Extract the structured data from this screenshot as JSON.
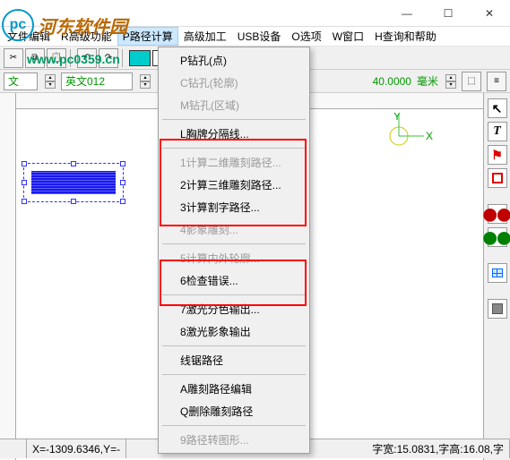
{
  "window": {
    "minimize": "—",
    "maximize": "☐",
    "close": "✕"
  },
  "watermark": {
    "logo_initials": "pc",
    "site_name": "河东软件园",
    "url": "www.pc0359.cn"
  },
  "menubar": {
    "items": [
      "文件编辑",
      "R高级功能",
      "P路径计算",
      "高级加工",
      "USB设备",
      "O选项",
      "W窗口",
      "H查询和帮助"
    ]
  },
  "toolbar1": {
    "colors": {
      "cyan": "#00cccc",
      "white": "#ffffff",
      "green": "#00cc00"
    }
  },
  "toolbar2": {
    "font_group": "文",
    "font_name": "英文012",
    "size_value": "40.0000",
    "size_unit": "毫米"
  },
  "dropdown": {
    "items": [
      {
        "label": "P钻孔(点)",
        "enabled": true
      },
      {
        "label": "C钻孔(轮廓)",
        "enabled": false
      },
      {
        "label": "M钻孔(区域)",
        "enabled": false
      },
      {
        "sep": true
      },
      {
        "label": "L胸牌分隔线...",
        "enabled": true
      },
      {
        "sep": true
      },
      {
        "label": "1计算二维雕刻路径...",
        "enabled": false
      },
      {
        "label": "2计算三维雕刻路径...",
        "enabled": true
      },
      {
        "label": "3计算割字路径...",
        "enabled": true
      },
      {
        "label": "4影象雕刻...",
        "enabled": false
      },
      {
        "sep": true
      },
      {
        "label": "5计算内外轮廓...",
        "enabled": false
      },
      {
        "label": "6检查错误...",
        "enabled": true
      },
      {
        "sep": true
      },
      {
        "label": "7激光分色输出...",
        "enabled": true
      },
      {
        "label": "8激光影象输出",
        "enabled": true
      },
      {
        "sep": true
      },
      {
        "label": "线锯路径",
        "enabled": true
      },
      {
        "sep": true
      },
      {
        "label": "A雕刻路径编辑",
        "enabled": true
      },
      {
        "label": "Q删除雕刻路径",
        "enabled": true
      },
      {
        "sep": true
      },
      {
        "label": "9路径转图形...",
        "enabled": false
      }
    ]
  },
  "origin": {
    "x": "X",
    "y": "Y"
  },
  "statusbar": {
    "coords": "X=-1309.6346,Y=-",
    "font_metrics": "字宽:15.0831,字高:16.08,字"
  }
}
